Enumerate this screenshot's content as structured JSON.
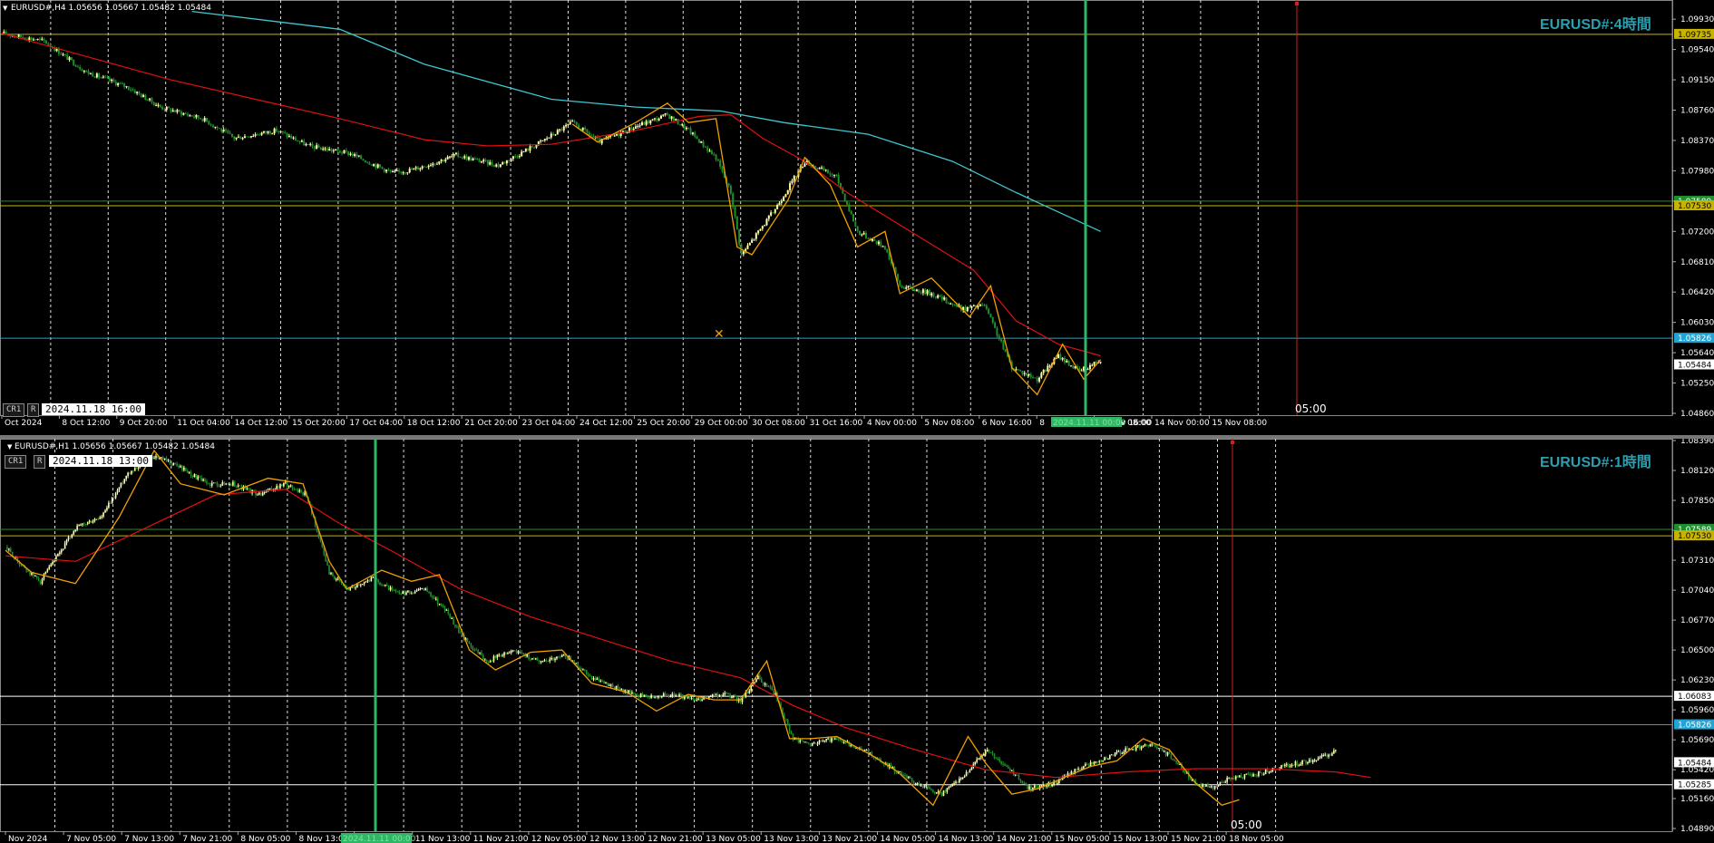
{
  "colors": {
    "background": "#000000",
    "bull": "#ffffaa",
    "bear": "#1f8f2e",
    "ma_red": "#e01010",
    "ma_cyan": "#3ec6d0",
    "zigzag": "#f0a000",
    "level_yellow": "#c8b400",
    "level_blue": "#21a5d6",
    "level_white": "#ffffff",
    "vline_green": "#2eb866",
    "vline_red": "#d02020",
    "title": "#2a9fb0"
  },
  "chart_data": [
    {
      "type": "candlestick",
      "symbol_label": "EURUSD#,H4  1.05656 1.05667 1.05482 1.05484",
      "title": "EURUSD#:4時間",
      "buttons": [
        "CR1",
        "R"
      ],
      "cursor_date": "2024.11.18 16:00",
      "ylim": [
        1.0486,
        1.1006
      ],
      "price_ticks": [
        "1.09930",
        "1.09540",
        "1.09150",
        "1.08760",
        "1.08370",
        "1.07980",
        "1.07590",
        "1.07200",
        "1.06810",
        "1.06420",
        "1.06030",
        "1.05640",
        "1.05250",
        "1.04860"
      ],
      "x_ticks": [
        "Oct 2024",
        "8 Oct 12:00",
        "9 Oct 20:00",
        "11 Oct 04:00",
        "14 Oct 12:00",
        "15 Oct 20:00",
        "17 Oct 04:00",
        "18 Oct 12:00",
        "21 Oct 20:00",
        "23 Oct 04:00",
        "24 Oct 12:00",
        "25 Oct 20:00",
        "29 Oct 00:00",
        "30 Oct 08:00",
        "31 Oct 16:00",
        "4 Nov 00:00",
        "5 Nov 08:00",
        "6 Nov 16:00",
        "8",
        "12 Nov 16:00",
        "14 Nov 00:00",
        "15 Nov 08:00"
      ],
      "x_tick_extra": "v 08:00",
      "vline_green_label": "2024.11.11 00:00",
      "vline_red_label": "05:00",
      "levels": [
        {
          "price": 1.09735,
          "label": "1.09735",
          "color": "yellow"
        },
        {
          "price": 1.07589,
          "label": "1.07589",
          "color": "green"
        },
        {
          "price": 1.0753,
          "label": "1.07530",
          "color": "yellow"
        },
        {
          "price": 1.05826,
          "label": "1.05826",
          "color": "blue"
        },
        {
          "price": 1.05484,
          "label": "1.05484",
          "color": "current"
        }
      ],
      "path_close": [
        [
          0,
          1.0975
        ],
        [
          20,
          1.0965
        ],
        [
          40,
          1.0925
        ],
        [
          60,
          1.0905
        ],
        [
          75,
          1.088
        ],
        [
          95,
          1.0865
        ],
        [
          110,
          1.084
        ],
        [
          130,
          1.085
        ],
        [
          145,
          1.083
        ],
        [
          165,
          1.082
        ],
        [
          185,
          1.0795
        ],
        [
          195,
          1.08
        ],
        [
          215,
          1.0818
        ],
        [
          235,
          1.0805
        ],
        [
          255,
          1.0835
        ],
        [
          270,
          1.086
        ],
        [
          283,
          1.0835
        ],
        [
          300,
          1.0855
        ],
        [
          315,
          1.087
        ],
        [
          325,
          1.085
        ],
        [
          338,
          1.0815
        ],
        [
          345,
          1.077
        ],
        [
          350,
          1.069
        ],
        [
          365,
          1.0745
        ],
        [
          380,
          1.081
        ],
        [
          395,
          1.079
        ],
        [
          405,
          1.072
        ],
        [
          418,
          1.07
        ],
        [
          425,
          1.065
        ],
        [
          440,
          1.064
        ],
        [
          455,
          1.062
        ],
        [
          465,
          1.0625
        ],
        [
          478,
          1.0545
        ],
        [
          490,
          1.053
        ],
        [
          500,
          1.056
        ],
        [
          510,
          1.054
        ],
        [
          520,
          1.0555
        ]
      ],
      "ma_red": [
        [
          0,
          1.0975
        ],
        [
          40,
          1.0945
        ],
        [
          80,
          1.0915
        ],
        [
          120,
          1.089
        ],
        [
          160,
          1.0865
        ],
        [
          200,
          1.0838
        ],
        [
          230,
          1.083
        ],
        [
          260,
          1.0832
        ],
        [
          300,
          1.085
        ],
        [
          330,
          1.0868
        ],
        [
          345,
          1.087
        ],
        [
          360,
          1.084
        ],
        [
          380,
          1.081
        ],
        [
          400,
          1.077
        ],
        [
          430,
          1.072
        ],
        [
          460,
          1.067
        ],
        [
          480,
          1.0605
        ],
        [
          500,
          1.0575
        ],
        [
          520,
          1.056
        ]
      ],
      "ma_cyan": [
        [
          90,
          1.1003
        ],
        [
          160,
          1.098
        ],
        [
          200,
          1.0935
        ],
        [
          260,
          1.089
        ],
        [
          300,
          1.088
        ],
        [
          340,
          1.0875
        ],
        [
          370,
          1.086
        ],
        [
          410,
          1.0845
        ],
        [
          450,
          1.081
        ],
        [
          480,
          1.077
        ],
        [
          520,
          1.072
        ]
      ],
      "zigzag": [
        [
          270,
          1.0858
        ],
        [
          282,
          1.0835
        ],
        [
          300,
          1.086
        ],
        [
          315,
          1.0885
        ],
        [
          325,
          1.086
        ],
        [
          338,
          1.0865
        ],
        [
          348,
          1.07
        ],
        [
          355,
          1.069
        ],
        [
          372,
          1.076
        ],
        [
          380,
          1.0815
        ],
        [
          392,
          1.078
        ],
        [
          405,
          1.07
        ],
        [
          418,
          1.072
        ],
        [
          425,
          1.064
        ],
        [
          440,
          1.066
        ],
        [
          458,
          1.061
        ],
        [
          468,
          1.065
        ],
        [
          478,
          1.0545
        ],
        [
          490,
          1.051
        ],
        [
          502,
          1.0575
        ],
        [
          512,
          1.053
        ],
        [
          520,
          1.0555
        ]
      ]
    },
    {
      "type": "candlestick",
      "symbol_label": "EURUSD#,H1  1.05656 1.05667 1.05482 1.05484",
      "title": "EURUSD#:1時間",
      "buttons": [
        "CR1",
        "R"
      ],
      "cursor_date": "2024.11.18 13:00",
      "ylim": [
        1.0489,
        1.0839
      ],
      "price_ticks": [
        "1.08390",
        "1.08120",
        "1.07850",
        "1.07580",
        "1.07310",
        "1.07040",
        "1.06770",
        "1.06500",
        "1.06230",
        "1.05960",
        "1.05690",
        "1.05420",
        "1.05160",
        "1.04890"
      ],
      "x_ticks": [
        "Nov 2024",
        "7 Nov 05:00",
        "7 Nov 13:00",
        "7 Nov 21:00",
        "8 Nov 05:00",
        "8 Nov 13:00",
        "11 Nov 05:00",
        "11 Nov 13:00",
        "11 Nov 21:00",
        "12 Nov 05:00",
        "12 Nov 13:00",
        "12 Nov 21:00",
        "13 Nov 05:00",
        "13 Nov 13:00",
        "13 Nov 21:00",
        "14 Nov 05:00",
        "14 Nov 13:00",
        "14 Nov 21:00",
        "15 Nov 05:00",
        "15 Nov 13:00",
        "15 Nov 21:00",
        "18 Nov 05:00"
      ],
      "vline_green_label": "2024.11.11 00:00",
      "vline_red_label": "05:00",
      "levels": [
        {
          "price": 1.07589,
          "label": "1.07589",
          "color": "green"
        },
        {
          "price": 1.0753,
          "label": "1.07530",
          "color": "yellow"
        },
        {
          "price": 1.06083,
          "label": "1.06083",
          "color": "white"
        },
        {
          "price": 1.05826,
          "label": "1.05826",
          "color": "blue"
        },
        {
          "price": 1.05484,
          "label": "1.05484",
          "color": "current"
        },
        {
          "price": 1.0542,
          "label": "1.05420",
          "color": "tick"
        },
        {
          "price": 1.05285,
          "label": "1.05285",
          "color": "white"
        }
      ],
      "path_close": [
        [
          0,
          1.0743
        ],
        [
          10,
          1.0725
        ],
        [
          20,
          1.0712
        ],
        [
          30,
          1.0735
        ],
        [
          40,
          1.076
        ],
        [
          55,
          1.077
        ],
        [
          70,
          1.081
        ],
        [
          85,
          1.0825
        ],
        [
          100,
          1.0815
        ],
        [
          115,
          1.08
        ],
        [
          130,
          1.08
        ],
        [
          145,
          1.079
        ],
        [
          160,
          1.08
        ],
        [
          172,
          1.079
        ],
        [
          185,
          1.072
        ],
        [
          195,
          1.0705
        ],
        [
          210,
          1.0715
        ],
        [
          225,
          1.07
        ],
        [
          240,
          1.0705
        ],
        [
          252,
          1.0685
        ],
        [
          262,
          1.066
        ],
        [
          275,
          1.064
        ],
        [
          290,
          1.065
        ],
        [
          305,
          1.064
        ],
        [
          320,
          1.0645
        ],
        [
          335,
          1.0625
        ],
        [
          350,
          1.0615
        ],
        [
          365,
          1.0608
        ],
        [
          380,
          1.061
        ],
        [
          395,
          1.0605
        ],
        [
          410,
          1.061
        ],
        [
          420,
          1.0605
        ],
        [
          430,
          1.0625
        ],
        [
          440,
          1.061
        ],
        [
          450,
          1.057
        ],
        [
          460,
          1.0565
        ],
        [
          475,
          1.057
        ],
        [
          490,
          1.056
        ],
        [
          505,
          1.0545
        ],
        [
          520,
          1.053
        ],
        [
          535,
          1.052
        ],
        [
          550,
          1.054
        ],
        [
          560,
          1.056
        ],
        [
          575,
          1.054
        ],
        [
          585,
          1.0525
        ],
        [
          600,
          1.053
        ],
        [
          615,
          1.0545
        ],
        [
          625,
          1.055
        ],
        [
          640,
          1.056
        ],
        [
          655,
          1.0565
        ],
        [
          665,
          1.0555
        ],
        [
          680,
          1.053
        ],
        [
          690,
          1.0525
        ],
        [
          700,
          1.0535
        ],
        [
          715,
          1.0538
        ],
        [
          730,
          1.0545
        ],
        [
          745,
          1.055
        ],
        [
          760,
          1.0558
        ]
      ],
      "ma_red": [
        [
          0,
          1.0735
        ],
        [
          40,
          1.073
        ],
        [
          80,
          1.076
        ],
        [
          120,
          1.079
        ],
        [
          160,
          1.0795
        ],
        [
          190,
          1.0765
        ],
        [
          220,
          1.074
        ],
        [
          260,
          1.0705
        ],
        [
          300,
          1.068
        ],
        [
          340,
          1.066
        ],
        [
          380,
          1.064
        ],
        [
          420,
          1.0625
        ],
        [
          450,
          1.06
        ],
        [
          480,
          1.058
        ],
        [
          520,
          1.056
        ],
        [
          560,
          1.0542
        ],
        [
          600,
          1.0535
        ],
        [
          640,
          1.054
        ],
        [
          680,
          1.0543
        ],
        [
          720,
          1.0543
        ],
        [
          760,
          1.054
        ]
      ],
      "ma_red_tail": [
        [
          760,
          1.054
        ],
        [
          780,
          1.0535
        ]
      ],
      "zigzag": [
        [
          0,
          1.074
        ],
        [
          15,
          1.072
        ],
        [
          40,
          1.071
        ],
        [
          65,
          1.077
        ],
        [
          85,
          1.083
        ],
        [
          100,
          1.08
        ],
        [
          125,
          1.079
        ],
        [
          150,
          1.0805
        ],
        [
          170,
          1.08
        ],
        [
          185,
          1.073
        ],
        [
          195,
          1.0705
        ],
        [
          215,
          1.0722
        ],
        [
          232,
          1.0712
        ],
        [
          248,
          1.0718
        ],
        [
          265,
          1.065
        ],
        [
          280,
          1.0632
        ],
        [
          300,
          1.0648
        ],
        [
          318,
          1.065
        ],
        [
          335,
          1.062
        ],
        [
          355,
          1.0612
        ],
        [
          372,
          1.0595
        ],
        [
          390,
          1.061
        ],
        [
          405,
          1.0605
        ],
        [
          420,
          1.0605
        ],
        [
          435,
          1.064
        ],
        [
          448,
          1.057
        ],
        [
          460,
          1.057
        ],
        [
          475,
          1.0572
        ],
        [
          495,
          1.0555
        ],
        [
          510,
          1.054
        ],
        [
          520,
          1.0525
        ],
        [
          530,
          1.051
        ],
        [
          550,
          1.0572
        ],
        [
          560,
          1.0548
        ],
        [
          575,
          1.052
        ],
        [
          590,
          1.0525
        ],
        [
          605,
          1.0535
        ],
        [
          620,
          1.0545
        ],
        [
          635,
          1.055
        ],
        [
          650,
          1.057
        ],
        [
          665,
          1.056
        ],
        [
          680,
          1.053
        ],
        [
          695,
          1.051
        ],
        [
          705,
          1.0515
        ]
      ]
    }
  ]
}
